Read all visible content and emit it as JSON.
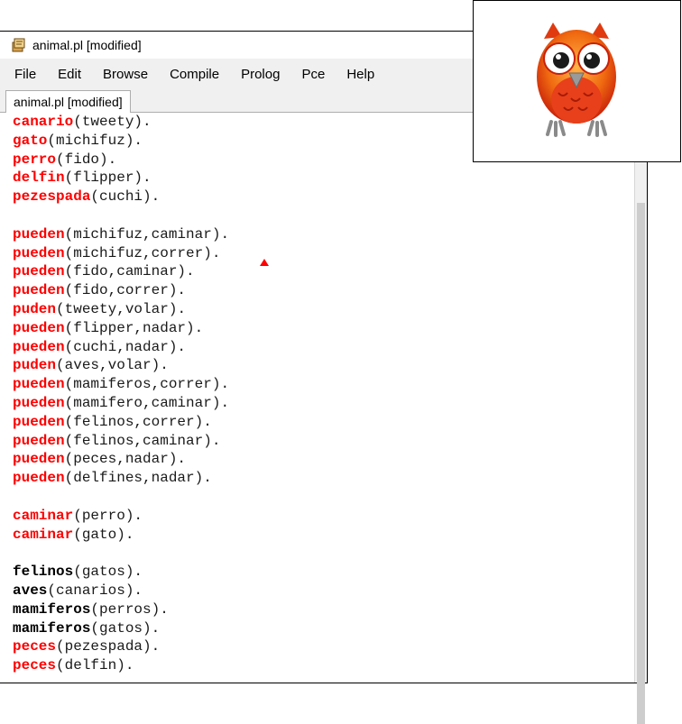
{
  "window": {
    "title": "animal.pl [modified]",
    "tab_label": "animal.pl [modified]"
  },
  "menu": [
    "File",
    "Edit",
    "Browse",
    "Compile",
    "Prolog",
    "Pce",
    "Help"
  ],
  "colors": {
    "predicate_red": "#ff0000",
    "predicate_black": "#000000",
    "owl_orange": "#f06a10"
  },
  "editor": {
    "lines": [
      {
        "pred": "canario",
        "args": "(tweety).",
        "color": "red"
      },
      {
        "pred": "gato",
        "args": "(michifuz).",
        "color": "red"
      },
      {
        "pred": "perro",
        "args": "(fido).",
        "color": "red"
      },
      {
        "pred": "delfin",
        "args": "(flipper).",
        "color": "red"
      },
      {
        "pred": "pezespada",
        "args": "(cuchi).",
        "color": "red"
      },
      {
        "pred": "",
        "args": "",
        "color": "red"
      },
      {
        "pred": "pueden",
        "args": "(michifuz,caminar).",
        "color": "red"
      },
      {
        "pred": "pueden",
        "args": "(michifuz,correr).",
        "color": "red"
      },
      {
        "pred": "pueden",
        "args": "(fido,caminar).",
        "color": "red"
      },
      {
        "pred": "pueden",
        "args": "(fido,correr).",
        "color": "red"
      },
      {
        "pred": "puden",
        "args": "(tweety,volar).",
        "color": "red"
      },
      {
        "pred": "pueden",
        "args": "(flipper,nadar).",
        "color": "red"
      },
      {
        "pred": "pueden",
        "args": "(cuchi,nadar).",
        "color": "red"
      },
      {
        "pred": "puden",
        "args": "(aves,volar).",
        "color": "red"
      },
      {
        "pred": "pueden",
        "args": "(mamiferos,correr).",
        "color": "red"
      },
      {
        "pred": "pueden",
        "args": "(mamifero,caminar).",
        "color": "red"
      },
      {
        "pred": "pueden",
        "args": "(felinos,correr).",
        "color": "red"
      },
      {
        "pred": "pueden",
        "args": "(felinos,caminar).",
        "color": "red"
      },
      {
        "pred": "pueden",
        "args": "(peces,nadar).",
        "color": "red"
      },
      {
        "pred": "pueden",
        "args": "(delfines,nadar).",
        "color": "red"
      },
      {
        "pred": "",
        "args": "",
        "color": "red"
      },
      {
        "pred": "caminar",
        "args": "(perro).",
        "color": "red"
      },
      {
        "pred": "caminar",
        "args": "(gato).",
        "color": "red"
      },
      {
        "pred": "",
        "args": "",
        "color": "red"
      },
      {
        "pred": "felinos",
        "args": "(gatos).",
        "color": "black"
      },
      {
        "pred": "aves",
        "args": "(canarios).",
        "color": "black"
      },
      {
        "pred": "mamiferos",
        "args": "(perros).",
        "color": "black"
      },
      {
        "pred": "mamiferos",
        "args": "(gatos).",
        "color": "black"
      },
      {
        "pred": "peces",
        "args": "(pezespada).",
        "color": "red"
      },
      {
        "pred": "peces",
        "args": "(delfin).",
        "color": "red"
      }
    ]
  },
  "icons": {
    "app": "swi-prolog-owl-icon",
    "logo": "swi-prolog-owl-logo",
    "error_marker": "error-triangle-icon"
  }
}
